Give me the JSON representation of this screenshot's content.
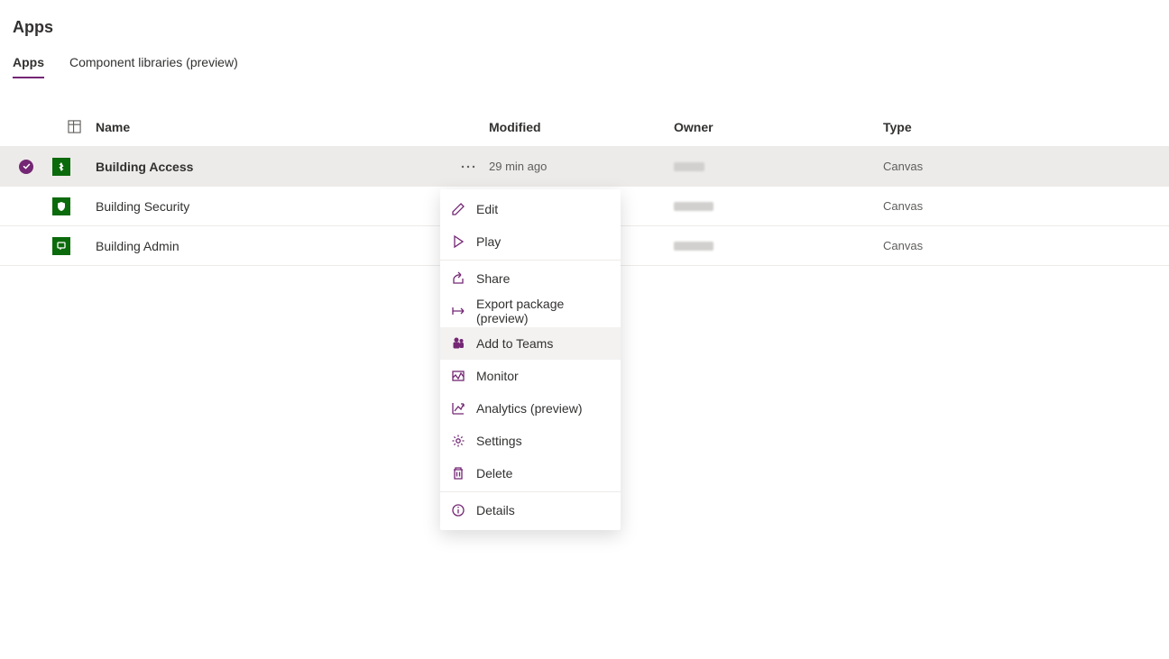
{
  "page": {
    "title": "Apps"
  },
  "tabs": {
    "apps": "Apps",
    "component_libraries": "Component libraries (preview)"
  },
  "columns": {
    "name": "Name",
    "modified": "Modified",
    "owner": "Owner",
    "type": "Type"
  },
  "rows": [
    {
      "name": "Building Access",
      "modified": "29 min ago",
      "type": "Canvas",
      "selected": true,
      "icon": "arrows-up-down"
    },
    {
      "name": "Building Security",
      "modified": "",
      "type": "Canvas",
      "selected": false,
      "icon": "shield"
    },
    {
      "name": "Building Admin",
      "modified": "",
      "type": "Canvas",
      "selected": false,
      "icon": "message"
    }
  ],
  "menu": {
    "edit": "Edit",
    "play": "Play",
    "share": "Share",
    "export": "Export package (preview)",
    "add_to_teams": "Add to Teams",
    "monitor": "Monitor",
    "analytics": "Analytics (preview)",
    "settings": "Settings",
    "delete": "Delete",
    "details": "Details"
  }
}
